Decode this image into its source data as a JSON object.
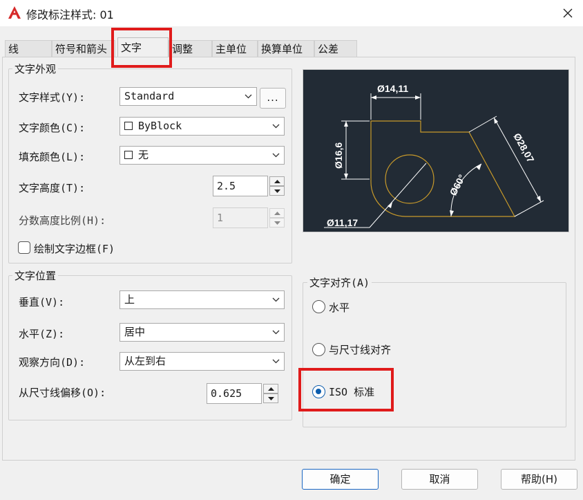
{
  "window": {
    "title": "修改标注样式: 01"
  },
  "tabs": [
    {
      "label": "线"
    },
    {
      "label": "符号和箭头"
    },
    {
      "label": "文字"
    },
    {
      "label": "调整"
    },
    {
      "label": "主单位"
    },
    {
      "label": "换算单位"
    },
    {
      "label": "公差"
    }
  ],
  "text_appearance": {
    "group_label": "文字外观",
    "style_label": "文字样式(Y):",
    "style_value": "Standard",
    "style_browse": "...",
    "color_label": "文字颜色(C):",
    "color_value": "ByBlock",
    "fill_label": "填充颜色(L):",
    "fill_value": "无",
    "height_label": "文字高度(T):",
    "height_value": "2.5",
    "fraction_label": "分数高度比例(H):",
    "fraction_value": "1",
    "frame_label": "绘制文字边框(F)"
  },
  "text_placement": {
    "group_label": "文字位置",
    "vertical_label": "垂直(V):",
    "vertical_value": "上",
    "horizontal_label": "水平(Z):",
    "horizontal_value": "居中",
    "view_label": "观察方向(D):",
    "view_value": "从左到右",
    "offset_label": "从尺寸线偏移(O):",
    "offset_value": "0.625"
  },
  "text_alignment": {
    "group_label": "文字对齐(A)",
    "options": [
      {
        "label": "水平",
        "checked": false
      },
      {
        "label": "与尺寸线对齐",
        "checked": false
      },
      {
        "label": "ISO 标准",
        "checked": true
      }
    ]
  },
  "preview": {
    "dim_top": "Ø14,11",
    "dim_left": "Ø16,6",
    "dim_right": "Ø28,07",
    "dim_angle": "Ø60°",
    "dim_bottom": "Ø11,17"
  },
  "buttons": {
    "ok": "确定",
    "cancel": "取消",
    "help": "帮助(H)"
  },
  "colors": {
    "accent": "#0b5cad",
    "highlight": "#e01b1b",
    "preview_bg": "#222b35",
    "preview_geometry": "#c89a2a",
    "preview_dim": "#ffffff"
  }
}
